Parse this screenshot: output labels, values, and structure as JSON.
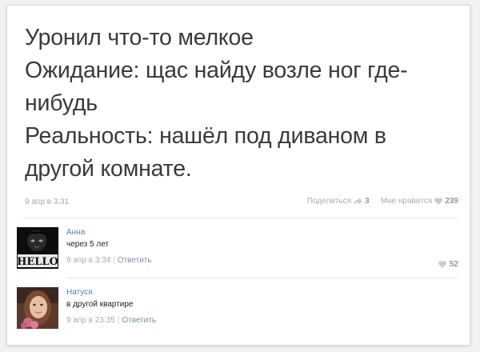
{
  "post": {
    "lines": [
      "Уронил что-то мелкое",
      "Ожидание: щас найду возле ног где-",
      "нибудь",
      "Реальность: нашёл под диваном в",
      "другой комнате."
    ],
    "date": "9 апр в 3:31",
    "share_label": "Поделиться",
    "share_count": "3",
    "like_label": "Мне нравится",
    "like_count": "239"
  },
  "comments": [
    {
      "author": "Анна",
      "text": "через 5 лет",
      "date": "9 апр в 3:34",
      "reply_label": "Ответить",
      "likes": "52",
      "avatar_text": "HELLO"
    },
    {
      "author": "Натуся",
      "text": "в другой квартире",
      "date": "9 апр в 23:35",
      "reply_label": "Ответить",
      "likes": null
    }
  ],
  "colors": {
    "link": "#5b7fa6",
    "muted": "#a5abb5",
    "icon": "#c6cdd8"
  }
}
